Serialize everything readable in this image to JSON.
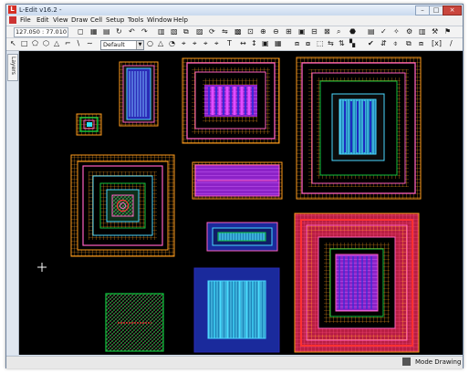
{
  "window": {
    "title": "L-Edit v16.2 -"
  },
  "menu": {
    "items": [
      "File",
      "Edit",
      "View",
      "Draw",
      "Cell",
      "Setup",
      "Tools",
      "Window",
      "Help"
    ]
  },
  "toolbar": {
    "coords": "127.050 : 77.010",
    "layer": "Default"
  },
  "sidebar": {
    "tab": "Layers"
  },
  "status": {
    "mode": "Mode Drawing"
  },
  "colors": {
    "canvas": "#000000",
    "orange": "#ff9d1c",
    "pink": "#ff5fc0",
    "red": "#ff3131",
    "purple": "#9a24d6",
    "blue": "#2b2bb7",
    "cyan": "#4ad7ff",
    "green": "#12c43e",
    "navy": "#1a2a9c"
  },
  "icons": [
    "select-icon",
    "box-icon",
    "polygon-icon",
    "wire-icon",
    "circle-icon",
    "text-icon",
    "port-icon",
    "zoom-icon"
  ]
}
